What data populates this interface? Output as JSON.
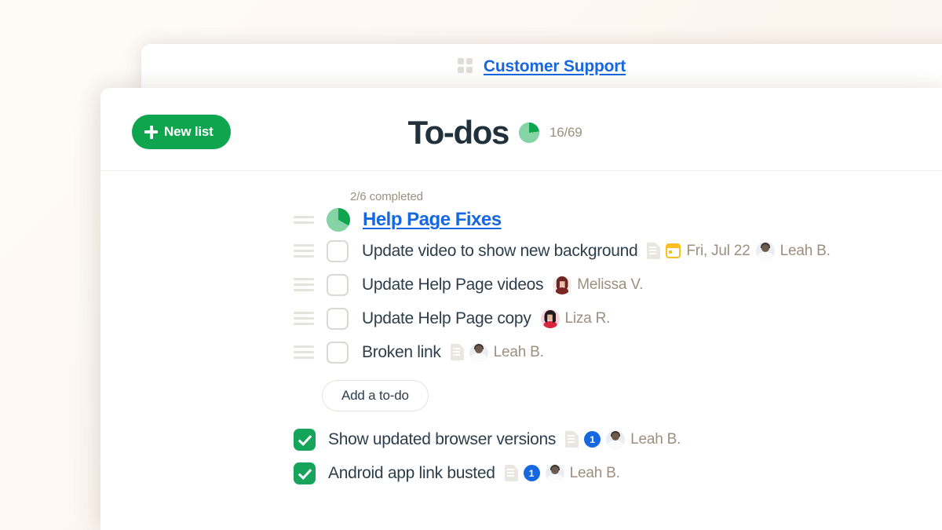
{
  "colors": {
    "page_background": "#fdf8f3",
    "brand_green": "#0ea54e",
    "check_green": "#16a45a",
    "pie_light": "#86d3a5",
    "pie_dark": "#0ea54e",
    "link_blue": "#1667e0",
    "badge_blue": "#1667e0",
    "title_navy": "#21313c",
    "meta_tan": "#9c8f7e",
    "calendar_yellow": "#fbbf24"
  },
  "back_window": {
    "grid_icon": "grid-icon",
    "project_link": "Customer Support"
  },
  "front_window": {
    "header": {
      "new_list_button": "New list",
      "plus_icon": "plus-icon",
      "title": "To-dos",
      "progress_pie_icon": "pie-chart-icon",
      "progress_count": "16/69",
      "progress_completed": 16,
      "progress_total": 69,
      "progress_percent": 23
    },
    "list": {
      "drag_handle_icon": "drag-handle-icon",
      "meta": "2/6 completed",
      "completed": 2,
      "total": 6,
      "percent": 33,
      "pie_icon": "pie-chart-icon",
      "title": "Help Page Fixes",
      "add_todo_button": "Add a to-do",
      "open_todos": [
        {
          "text": "Update video to show new background",
          "checked": false,
          "drag_handle_icon": "drag-handle-icon",
          "checkbox_icon": "checkbox-unchecked-icon",
          "notes_icon": "document-icon",
          "calendar_icon": "calendar-icon",
          "due_date": "Fri, Jul 22",
          "avatar_icon": "avatar-leah",
          "assignee": "Leah B."
        },
        {
          "text": "Update Help Page videos",
          "checked": false,
          "drag_handle_icon": "drag-handle-icon",
          "checkbox_icon": "checkbox-unchecked-icon",
          "avatar_icon": "avatar-melissa",
          "assignee": "Melissa V."
        },
        {
          "text": "Update Help Page copy",
          "checked": false,
          "drag_handle_icon": "drag-handle-icon",
          "checkbox_icon": "checkbox-unchecked-icon",
          "avatar_icon": "avatar-liza",
          "assignee": "Liza R."
        },
        {
          "text": "Broken link",
          "checked": false,
          "drag_handle_icon": "drag-handle-icon",
          "checkbox_icon": "checkbox-unchecked-icon",
          "notes_icon": "document-icon",
          "avatar_icon": "avatar-leah",
          "assignee": "Leah B."
        }
      ],
      "completed_todos": [
        {
          "text": "Show updated browser versions",
          "checked": true,
          "checkbox_icon": "checkbox-checked-icon",
          "notes_icon": "document-icon",
          "comment_count": "1",
          "avatar_icon": "avatar-leah",
          "assignee": "Leah B."
        },
        {
          "text": "Android app link busted",
          "checked": true,
          "checkbox_icon": "checkbox-checked-icon",
          "notes_icon": "document-icon",
          "comment_count": "1",
          "avatar_icon": "avatar-leah",
          "assignee": "Leah B."
        }
      ]
    }
  }
}
